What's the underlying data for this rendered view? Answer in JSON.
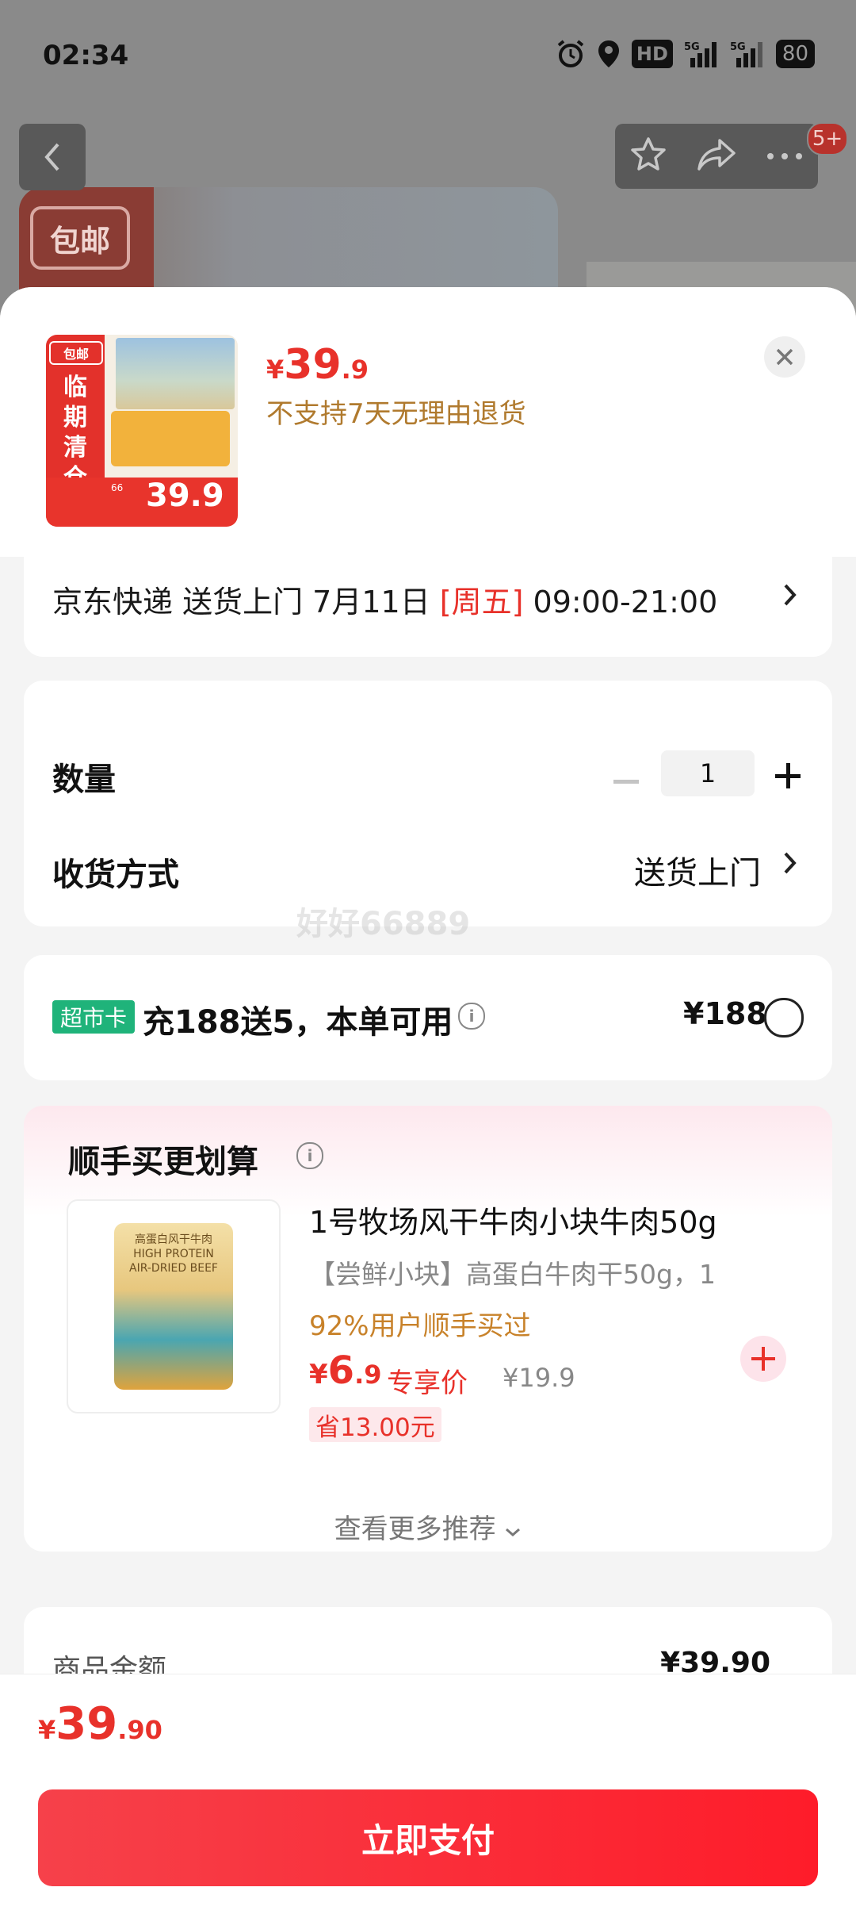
{
  "status_bar": {
    "time": "02:34",
    "hd_label": "HD",
    "net1": "5G",
    "net2": "5G",
    "battery": "80"
  },
  "nav": {
    "badge": "5+",
    "bg_tag": "包邮"
  },
  "product": {
    "thumb": {
      "tag": "包邮",
      "vertical_text": "临期清仓",
      "old_price": "66",
      "price": "39.9"
    },
    "price_yen": "¥",
    "price_int": "39",
    "price_dec": ".9",
    "return_note": "不支持7天无理由退货"
  },
  "delivery": {
    "text_before": "京东快递 送货上门 7月11日 ",
    "day": "[周五]",
    "text_after": " 09:00-21:00"
  },
  "quantity": {
    "label": "数量",
    "value": "1",
    "minus": "−",
    "plus": "+"
  },
  "shipping": {
    "label": "收货方式",
    "value": "送货上门"
  },
  "watermark": "好好66889",
  "promo": {
    "tag": "超市卡",
    "text": "充188送5，本单可用",
    "price": "¥188"
  },
  "recommend": {
    "title": "顺手买更划算",
    "item": {
      "name": "1号牧场风干牛肉小块牛肉50g",
      "subtitle": "【尝鲜小块】高蛋白牛肉干50g，1",
      "stat": "92%用户顺手买过",
      "price_yen": "¥",
      "price_int": "6",
      "price_dec": ".9",
      "price_label": "专享价",
      "original_price": "¥19.9",
      "saving": "省13.00元",
      "bag_text": "高蛋白风干牛肉 HIGH PROTEIN AIR-DRIED BEEF"
    },
    "more": "查看更多推荐"
  },
  "summary": {
    "label": "商品金额",
    "value": "¥39.90"
  },
  "footer": {
    "total_yen": "¥",
    "total_int": "39",
    "total_dec": ".90",
    "pay_label": "立即支付"
  },
  "colors": {
    "accent": "#e8312a",
    "promo_tag": "#1fb37a",
    "stat": "#c8822a"
  }
}
